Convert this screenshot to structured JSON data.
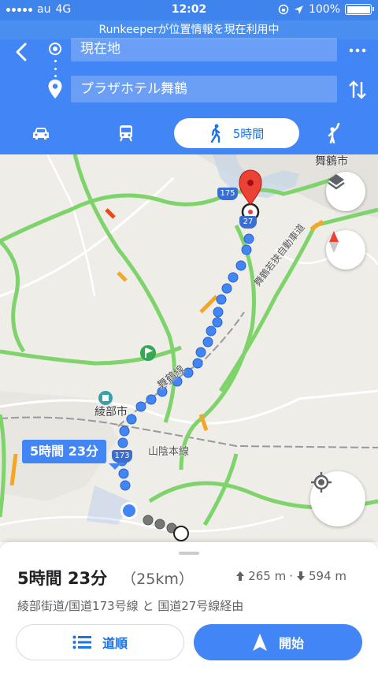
{
  "status_bar": {
    "carrier": "au",
    "network": "4G",
    "time": "12:02",
    "battery": "100%"
  },
  "banner": {
    "text": "Runkeeperが位置情報を現在利用中"
  },
  "directions": {
    "origin": "現在地",
    "destination": "プラザホテル舞鶴",
    "icons": [
      "back-icon",
      "more-icon",
      "swap-icon",
      "origin-dot-icon",
      "destination-pin-icon"
    ]
  },
  "modes": {
    "walk_label": "5時間",
    "icons": [
      "car-icon",
      "train-icon",
      "walk-icon",
      "hail-icon"
    ],
    "selected": "walk"
  },
  "map": {
    "labels": {
      "city_maizuru": "舞鶴市",
      "city_ayabe": "綾部市",
      "expressway": "舞鶴若狭自動車道",
      "rail_maizuru": "舞鶴線",
      "rail_sanin": "山陰本線"
    },
    "shields": {
      "r175": "175",
      "r27": "27",
      "r173": "173"
    },
    "route_callout": "5時間 23分",
    "colors": {
      "route": "#4285f4",
      "road_green": "#7ed36b",
      "road_orange": "#f5a623",
      "road_red": "#e64a19",
      "pin": "#ea4335"
    }
  },
  "sheet": {
    "duration": "5時間 23分",
    "distance": "（25km）",
    "elevation_up": "265 m",
    "elevation_sep": "·",
    "elevation_down": "594 m",
    "via": "綾部街道/国道173号線 と 国道27号線経由",
    "steps_label": "道順",
    "start_label": "開始"
  }
}
